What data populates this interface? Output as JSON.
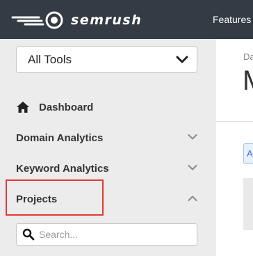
{
  "header": {
    "brand": "semrush",
    "nav_features": "Features"
  },
  "sidebar": {
    "tools_select": {
      "value": "All Tools"
    },
    "items": [
      {
        "label": "Dashboard",
        "icon": "home-icon"
      },
      {
        "label": "Domain Analytics",
        "icon": "chevron-down-icon",
        "expanded": false
      },
      {
        "label": "Keyword Analytics",
        "icon": "chevron-down-icon",
        "expanded": false
      },
      {
        "label": "Projects",
        "icon": "chevron-up-icon",
        "expanded": true,
        "highlighted": true
      }
    ],
    "search": {
      "placeholder": "Search...",
      "value": ""
    }
  },
  "main": {
    "breadcrumb": "Da",
    "title": "M",
    "tab_label": "A"
  },
  "colors": {
    "topbar": "#333b44",
    "sidebar_bg": "#ececec",
    "highlight": "#e53935",
    "brand_orange": "#ff642d"
  }
}
